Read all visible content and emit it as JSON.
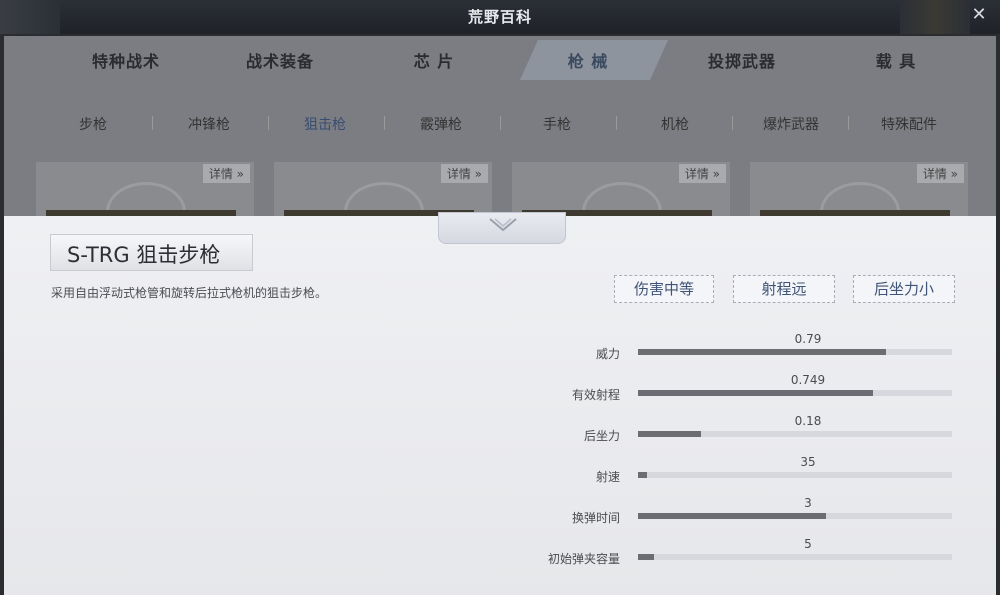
{
  "window": {
    "title": "荒野百科",
    "close_label": "✕"
  },
  "categories": [
    {
      "label": "特种战术",
      "active": false
    },
    {
      "label": "战术装备",
      "active": false
    },
    {
      "label": "芯 片",
      "active": false
    },
    {
      "label": "枪 械",
      "active": true
    },
    {
      "label": "投掷武器",
      "active": false
    },
    {
      "label": "载 具",
      "active": false
    }
  ],
  "subtabs": [
    {
      "label": "步枪",
      "active": false
    },
    {
      "label": "冲锋枪",
      "active": false
    },
    {
      "label": "狙击枪",
      "active": true
    },
    {
      "label": "霰弹枪",
      "active": false
    },
    {
      "label": "手枪",
      "active": false
    },
    {
      "label": "机枪",
      "active": false
    },
    {
      "label": "爆炸武器",
      "active": false
    },
    {
      "label": "特殊配件",
      "active": false
    }
  ],
  "cards": [
    {
      "detail_label": "详情 »"
    },
    {
      "detail_label": "详情 »"
    },
    {
      "detail_label": "详情 »"
    },
    {
      "detail_label": "详情 »"
    }
  ],
  "weapon": {
    "name": "S-TRG 狙击步枪",
    "description": "采用自由浮动式枪管和旋转后拉式枪机的狙击步枪。",
    "tags": [
      "伤害中等",
      "射程远",
      "后坐力小"
    ]
  },
  "stats": [
    {
      "label": "威力",
      "value": "0.79",
      "fill": 0.79
    },
    {
      "label": "有效射程",
      "value": "0.749",
      "fill": 0.749
    },
    {
      "label": "后坐力",
      "value": "0.18",
      "fill": 0.2
    },
    {
      "label": "射速",
      "value": "35",
      "fill": 0.03
    },
    {
      "label": "换弹时间",
      "value": "3",
      "fill": 0.6
    },
    {
      "label": "初始弹夹容量",
      "value": "5",
      "fill": 0.05
    }
  ],
  "colors": {
    "accent": "#3f5476",
    "bar_fill": "#6b6d72",
    "bar_track": "#d6d8de"
  }
}
